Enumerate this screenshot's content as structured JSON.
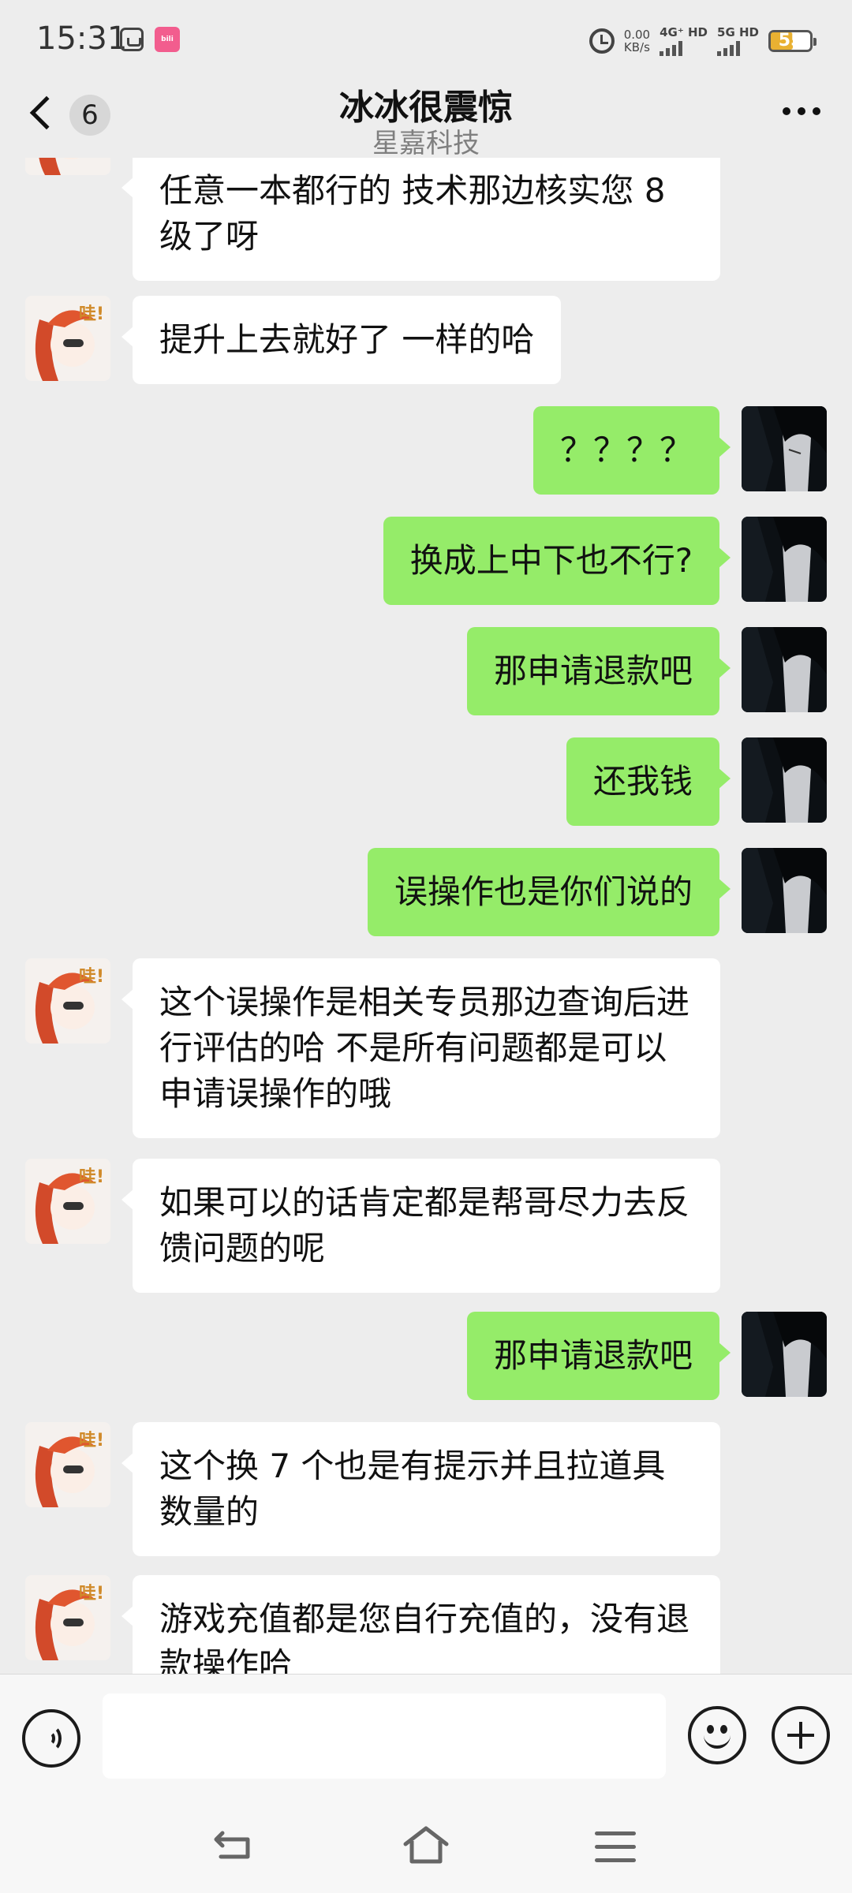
{
  "status_bar": {
    "time": "15:31",
    "speed_value": "0.00",
    "speed_unit": "KB/s",
    "network1": "4G⁺ HD",
    "network2": "5G HD",
    "battery": "55",
    "icons": [
      "gallery-app-icon",
      "bilibili-app-icon",
      "alarm-icon",
      "signal-icon",
      "battery-icon"
    ]
  },
  "header": {
    "unread_count": "6",
    "title": "冰冰很震惊",
    "subtitle": "星嘉科技"
  },
  "messages": [
    {
      "side": "left",
      "text": "任意一本都行的 技术那边核实您 8 级了呀"
    },
    {
      "side": "left",
      "text": "提升上去就好了 一样的哈"
    },
    {
      "side": "right",
      "text": "？？？？"
    },
    {
      "side": "right",
      "text": "换成上中下也不行?"
    },
    {
      "side": "right",
      "text": "那申请退款吧"
    },
    {
      "side": "right",
      "text": "还我钱"
    },
    {
      "side": "right",
      "text": "误操作也是你们说的"
    },
    {
      "side": "left",
      "text": "这个误操作是相关专员那边查询后进行评估的哈 不是所有问题都是可以申请误操作的哦"
    },
    {
      "side": "left",
      "text": "如果可以的话肯定都是帮哥尽力去反馈问题的呢"
    },
    {
      "side": "right",
      "text": "那申请退款吧"
    },
    {
      "side": "left",
      "text": "这个换 7 个也是有提示并且拉道具数量的"
    },
    {
      "side": "left",
      "text": "游戏充值都是您自行充值的，没有退款操作哈"
    }
  ],
  "input": {
    "placeholder": ""
  },
  "colors": {
    "background": "#ededed",
    "sent_bubble": "#95ec69",
    "received_bubble": "#ffffff",
    "battery": "#e9b132"
  }
}
